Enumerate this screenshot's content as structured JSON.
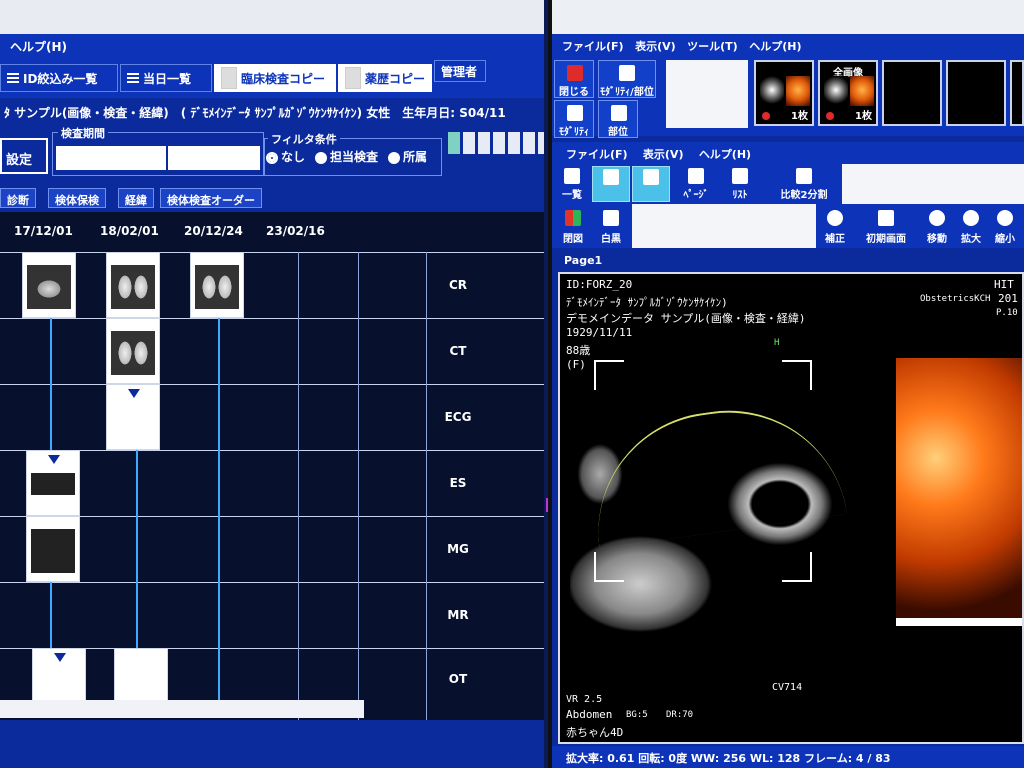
{
  "left": {
    "menu": {
      "help": "ヘルプ(H)"
    },
    "toolbar": {
      "id_list": "ID絞込み一覧",
      "today_list": "当日一覧",
      "clinical_copy": "臨床検査コピー",
      "history_copy": "薬歴コピー",
      "admin": "管理者"
    },
    "patient_line": "ﾀ サンプル(画像・検査・経緯)　( ﾃﾞﾓﾒｲﾝﾃﾞｰﾀ ｻﾝﾌﾟﾙｶﾞｿﾞｳｹﾝｻｹｲｹﾝ) 女性　生年月日: S04/11",
    "filters": {
      "settei": "設定",
      "period_label": "検査期間",
      "filter_label": "フィルタ条件",
      "opt_none": "なし",
      "opt_assigned": "担当検査",
      "opt_dept": "所属"
    },
    "tabs": [
      "診断",
      "検体保検",
      "経緯",
      "検体検査オーダー"
    ],
    "dates": [
      "17/12/01",
      "18/02/01",
      "20/12/24",
      "23/02/16"
    ],
    "modalities": [
      "CR",
      "CT",
      "ECG",
      "ES",
      "MG",
      "MR",
      "OT"
    ]
  },
  "right": {
    "menu1": {
      "file": "ファイル(F)",
      "view": "表示(V)",
      "tools": "ツール(T)",
      "help": "ヘルプ(H)"
    },
    "tool1": {
      "close": "閉じる",
      "modality_part": "ﾓﾀﾞﾘﾃｨ/部位",
      "modality": "ﾓﾀﾞﾘﾃｨ",
      "part": "部位"
    },
    "series": [
      {
        "title": "",
        "count": "1枚"
      },
      {
        "title": "全画像",
        "count": "1枚"
      }
    ],
    "menu2": {
      "file": "ファイル(F)",
      "view": "表示(V)",
      "help": "ヘルプ(H)"
    },
    "tool2": {
      "one_list": "一覧",
      "page": "ﾍﾟｰｼﾞ",
      "list": "ﾘｽﾄ",
      "compare": "比較2分割"
    },
    "tool3": {
      "close": "閉図",
      "white_black": "白黒",
      "correct": "補正",
      "init": "初期画面",
      "move": "移動",
      "zoom": "拡大",
      "shrink": "縮小"
    },
    "page_label": "Page1",
    "overlay": {
      "id": "ID:FORZ_20",
      "kana": "ﾃﾞﾓﾒｲﾝﾃﾞｰﾀ ｻﾝﾌﾟﾙｶﾞｿﾞｳｹﾝｻｹｲｹﾝ)",
      "name": "デモメインデータ サンプル(画像・検査・経緯)",
      "dob": "1929/11/11",
      "age": "88歳",
      "sex": "(F)",
      "hospital_top": "HIT",
      "hospital": "ObstetricsKCH",
      "year": "201",
      "probe_p": "P.10",
      "vr": "VR 2.5",
      "preset": "Abdomen",
      "bg": "BG:5",
      "dr": "DR:70",
      "baby": "赤ちゃん4D",
      "cv": "CV714",
      "marker_h": "H"
    },
    "status": "拡大率: 0.61 回転: 0度 WW: 256 WL: 128 フレーム: 4 / 83"
  }
}
